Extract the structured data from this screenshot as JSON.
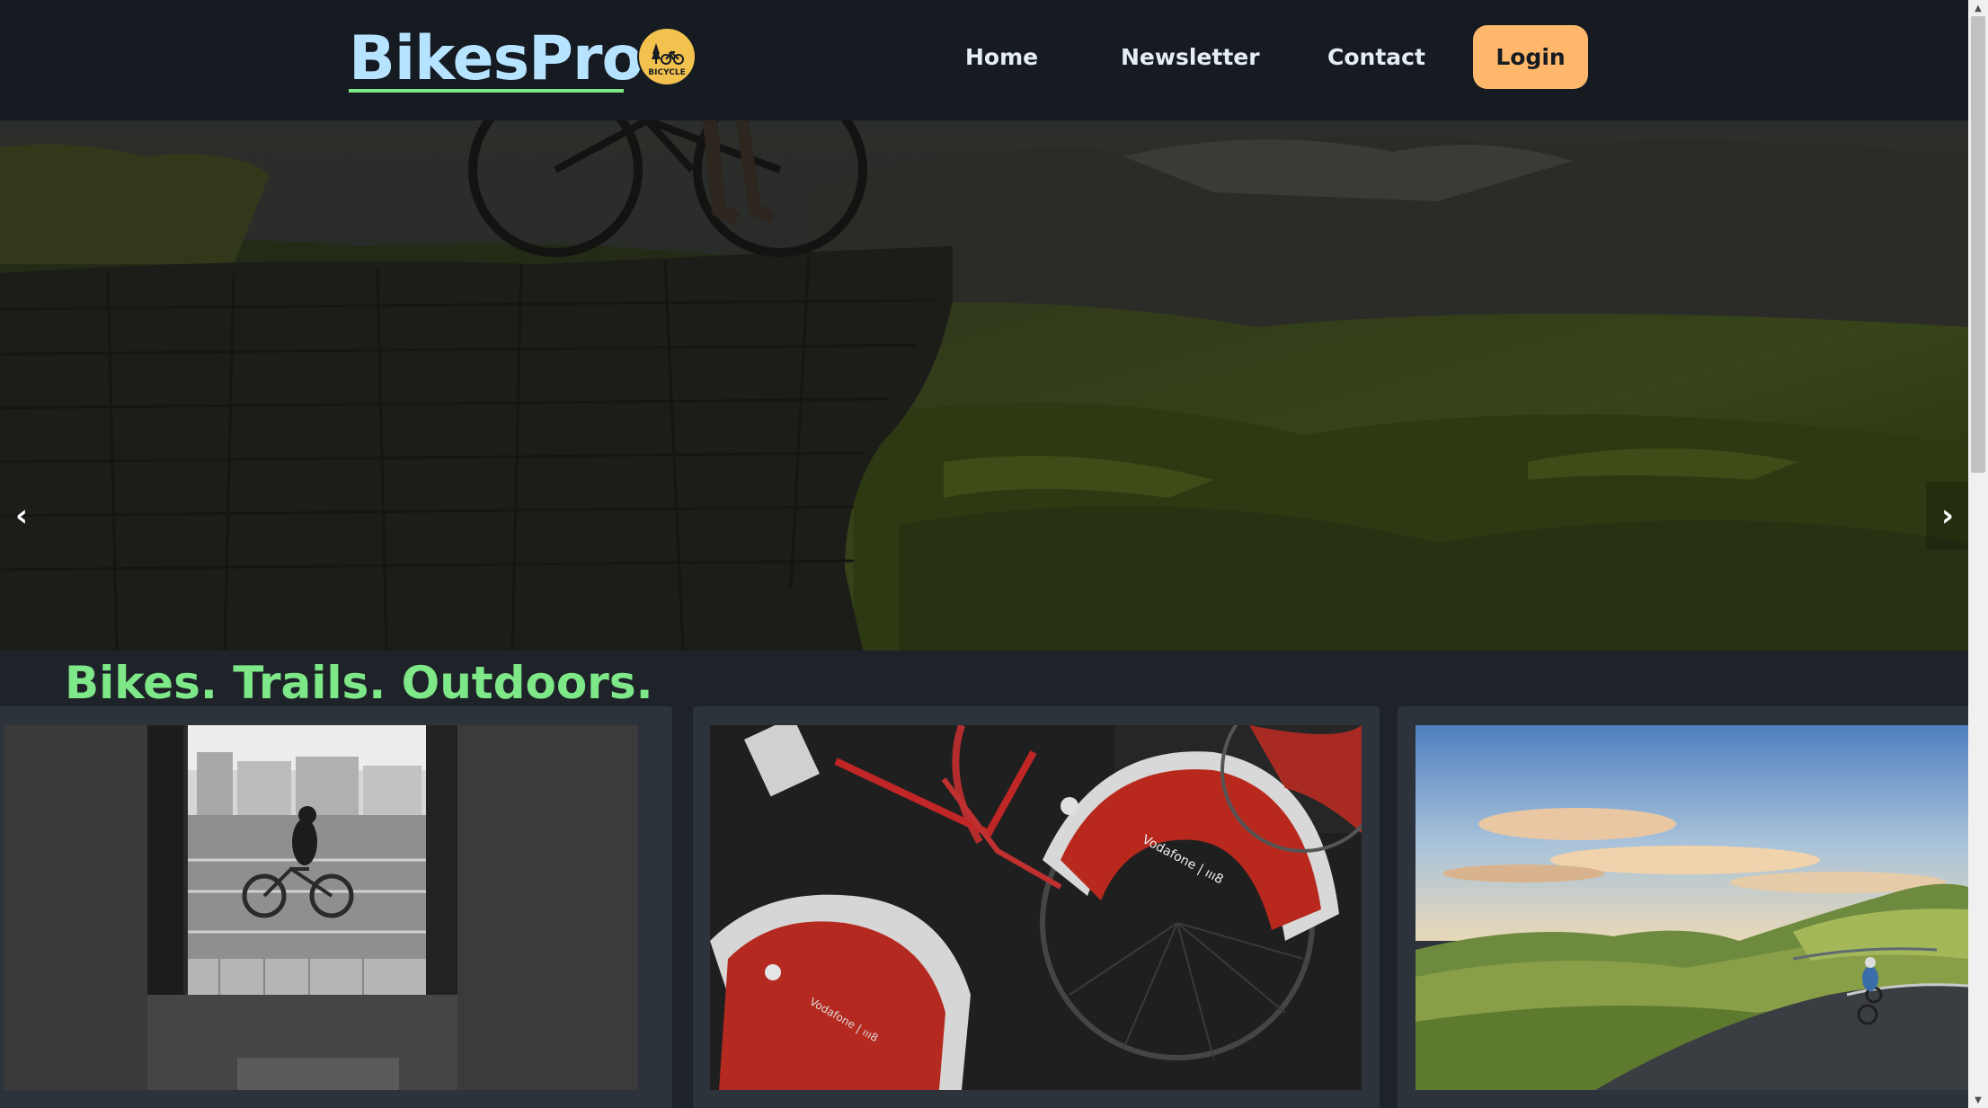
{
  "header": {
    "logo": "BikesPro",
    "badge_text": "BICYCLE",
    "nav": [
      "Home",
      "Newsletter",
      "Contact"
    ],
    "login_label": "Login"
  },
  "hero": {
    "prev_icon": "‹",
    "next_icon": "›"
  },
  "tagline": "Bikes. Trails. Outdoors.",
  "cards": [
    {
      "image": "cyclist-through-archway-bw-photo"
    },
    {
      "image": "red-rental-bike-fenders-photo",
      "fender_text": "Vodafone | ııı8"
    },
    {
      "image": "cyclist-on-mountain-road-photo"
    }
  ],
  "colors": {
    "header_bg": "#161b22",
    "page_bg": "#1e2329",
    "logo": "#b6e3ff",
    "accent_green": "#7ee787",
    "login_bg": "#ffb86b",
    "card_bg": "#2d333b"
  }
}
